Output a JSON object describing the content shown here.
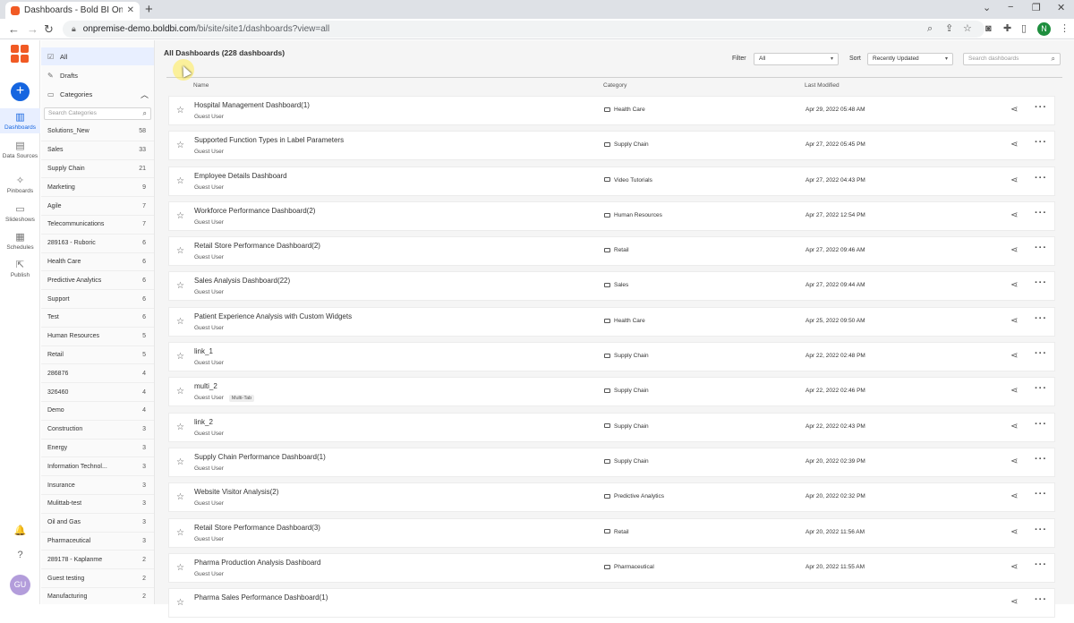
{
  "browser": {
    "tab_title": "Dashboards - Bold BI On-Premise",
    "tab_close": "✕",
    "new_tab": "+",
    "url_host": "onpremise-demo.boldbi.com",
    "url_path": "/bi/site/site1/dashboards?view=all",
    "profile_initial": "N"
  },
  "rail": {
    "items": [
      {
        "label": "Dashboards",
        "icon": "bar-chart-icon",
        "glyph": "▥"
      },
      {
        "label": "Data Sources",
        "icon": "database-icon",
        "glyph": "▤"
      },
      {
        "label": "Pinboards",
        "icon": "pin-icon",
        "glyph": "✧"
      },
      {
        "label": "Slideshows",
        "icon": "slideshow-icon",
        "glyph": "▭"
      },
      {
        "label": "Schedules",
        "icon": "calendar-icon",
        "glyph": "▦"
      },
      {
        "label": "Publish",
        "icon": "publish-icon",
        "glyph": "⇱"
      }
    ],
    "create": "+",
    "notifications_glyph": "🔔",
    "help_glyph": "?",
    "avatar": "GU"
  },
  "sidebar": {
    "all": "All",
    "drafts": "Drafts",
    "categories": "Categories",
    "search_placeholder": "Search Categories",
    "categories_list": [
      {
        "name": "Solutions_New",
        "count": "58"
      },
      {
        "name": "Sales",
        "count": "33"
      },
      {
        "name": "Supply Chain",
        "count": "21"
      },
      {
        "name": "Marketing",
        "count": "9"
      },
      {
        "name": "Agile",
        "count": "7"
      },
      {
        "name": "Telecommunications",
        "count": "7"
      },
      {
        "name": "289163 - Ruboric",
        "count": "6"
      },
      {
        "name": "Health Care",
        "count": "6"
      },
      {
        "name": "Predictive Analytics",
        "count": "6"
      },
      {
        "name": "Support",
        "count": "6"
      },
      {
        "name": "Test",
        "count": "6"
      },
      {
        "name": "Human Resources",
        "count": "5"
      },
      {
        "name": "Retail",
        "count": "5"
      },
      {
        "name": "286876",
        "count": "4"
      },
      {
        "name": "326460",
        "count": "4"
      },
      {
        "name": "Demo",
        "count": "4"
      },
      {
        "name": "Construction",
        "count": "3"
      },
      {
        "name": "Energy",
        "count": "3"
      },
      {
        "name": "Information Technol...",
        "count": "3"
      },
      {
        "name": "Insurance",
        "count": "3"
      },
      {
        "name": "Mulittab-test",
        "count": "3"
      },
      {
        "name": "Oil and Gas",
        "count": "3"
      },
      {
        "name": "Pharmaceutical",
        "count": "3"
      },
      {
        "name": "289178 - Kaplanme",
        "count": "2"
      },
      {
        "name": "Guest testing",
        "count": "2"
      },
      {
        "name": "Manufacturing",
        "count": "2"
      }
    ]
  },
  "main": {
    "title": "All Dashboards (228 dashboards)",
    "filter_label": "Filter",
    "filter_value": "All",
    "sort_label": "Sort",
    "sort_value": "Recently Updated",
    "search_placeholder": "Search dashboards",
    "columns": {
      "name": "Name",
      "category": "Category",
      "modified": "Last Modified"
    },
    "dashboards": [
      {
        "name": "Hospital Management Dashboard(1)",
        "owner": "Guest User",
        "category": "Health Care",
        "modified": "Apr 29, 2022 05:48 AM"
      },
      {
        "name": "Supported Function Types in Label Parameters",
        "owner": "Guest User",
        "category": "Supply Chain",
        "modified": "Apr 27, 2022 05:45 PM"
      },
      {
        "name": "Employee Details Dashboard",
        "owner": "Guest User",
        "category": "Video Tutorials",
        "modified": "Apr 27, 2022 04:43 PM"
      },
      {
        "name": "Workforce Performance Dashboard(2)",
        "owner": "Guest User",
        "category": "Human Resources",
        "modified": "Apr 27, 2022 12:54 PM"
      },
      {
        "name": "Retail Store Performance Dashboard(2)",
        "owner": "Guest User",
        "category": "Retail",
        "modified": "Apr 27, 2022 09:46 AM"
      },
      {
        "name": "Sales Analysis Dashboard(22)",
        "owner": "Guest User",
        "category": "Sales",
        "modified": "Apr 27, 2022 09:44 AM"
      },
      {
        "name": "Patient Experience Analysis with Custom Widgets",
        "owner": "Guest User",
        "category": "Health Care",
        "modified": "Apr 25, 2022 09:50 AM"
      },
      {
        "name": "link_1",
        "owner": "Guest User",
        "category": "Supply Chain",
        "modified": "Apr 22, 2022 02:48 PM"
      },
      {
        "name": "multi_2",
        "owner": "Guest User",
        "tag": "Multi-Tab",
        "category": "Supply Chain",
        "modified": "Apr 22, 2022 02:46 PM"
      },
      {
        "name": "link_2",
        "owner": "Guest User",
        "category": "Supply Chain",
        "modified": "Apr 22, 2022 02:43 PM"
      },
      {
        "name": "Supply Chain Performance Dashboard(1)",
        "owner": "Guest User",
        "category": "Supply Chain",
        "modified": "Apr 20, 2022 02:39 PM"
      },
      {
        "name": "Website Visitor Analysis(2)",
        "owner": "Guest User",
        "category": "Predictive Analytics",
        "modified": "Apr 20, 2022 02:32 PM"
      },
      {
        "name": "Retail Store Performance Dashboard(3)",
        "owner": "Guest User",
        "category": "Retail",
        "modified": "Apr 20, 2022 11:56 AM"
      },
      {
        "name": "Pharma Production Analysis Dashboard",
        "owner": "Guest User",
        "category": "Pharmaceutical",
        "modified": "Apr 20, 2022 11:55 AM"
      },
      {
        "name": "Pharma Sales Performance Dashboard(1)",
        "owner": "",
        "category": "",
        "modified": ""
      }
    ]
  },
  "colors": {
    "accent": "#1565e0",
    "brand": "#f15a24",
    "active_bg": "#e8efff"
  }
}
